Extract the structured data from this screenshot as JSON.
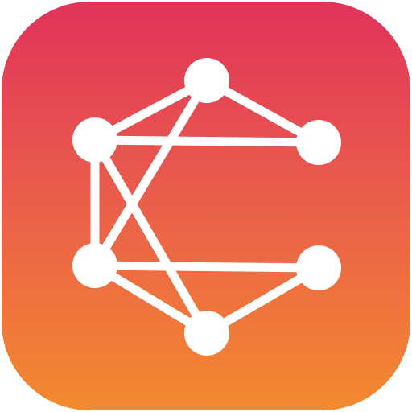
{
  "icon": {
    "name": "network-graph-app-icon",
    "glyph": "letter-c-graph-glyph",
    "gradient": {
      "top": "#e0335a",
      "middle": "#ea5f4a",
      "bottom": "#f38a2e"
    },
    "glyph_color": "#ffffff",
    "nodes": [
      {
        "id": "top"
      },
      {
        "id": "upper-left"
      },
      {
        "id": "upper-right"
      },
      {
        "id": "lower-left"
      },
      {
        "id": "lower-right"
      },
      {
        "id": "bottom"
      }
    ],
    "edges": [
      [
        "upper-left",
        "top"
      ],
      [
        "top",
        "upper-right"
      ],
      [
        "upper-left",
        "upper-right"
      ],
      [
        "top",
        "lower-left"
      ],
      [
        "upper-left",
        "lower-left"
      ],
      [
        "upper-left",
        "bottom"
      ],
      [
        "lower-left",
        "lower-right"
      ],
      [
        "lower-left",
        "bottom"
      ],
      [
        "lower-right",
        "bottom"
      ]
    ]
  }
}
